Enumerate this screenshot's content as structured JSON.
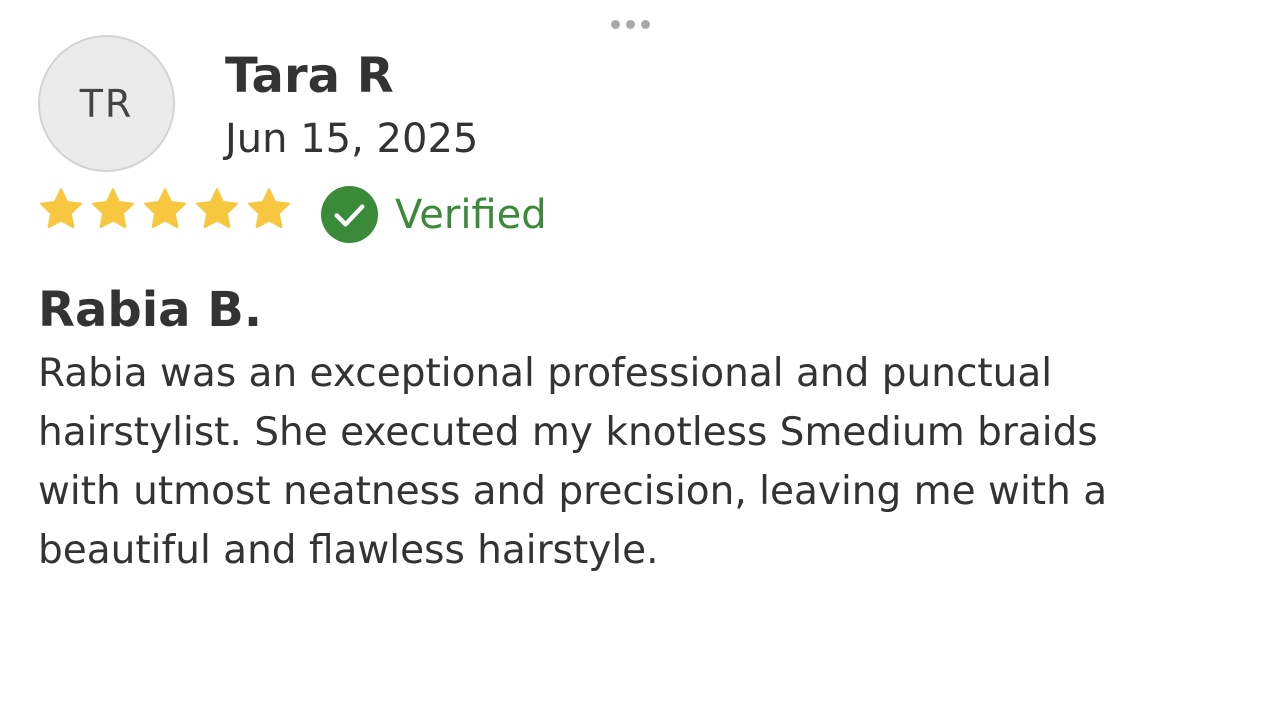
{
  "menu": {
    "icon": "more-horizontal-icon"
  },
  "reviewer": {
    "initials": "TR",
    "name": "Tara R",
    "date": "Jun 15, 2025"
  },
  "rating": {
    "value": 5,
    "max": 5,
    "star_color": "#f7c83f",
    "icon": "star-icon"
  },
  "verified": {
    "label": "Verified",
    "color": "#3a8a3a",
    "icon": "check-circle-icon"
  },
  "review": {
    "provider": "Rabia B.",
    "lines": [
      "Rabia was an exceptional professional and punctual",
      "hairstylist. She executed my knotless Smedium braids",
      "with utmost neatness and precision, leaving me with a",
      "beautiful and flawless hairstyle."
    ]
  }
}
